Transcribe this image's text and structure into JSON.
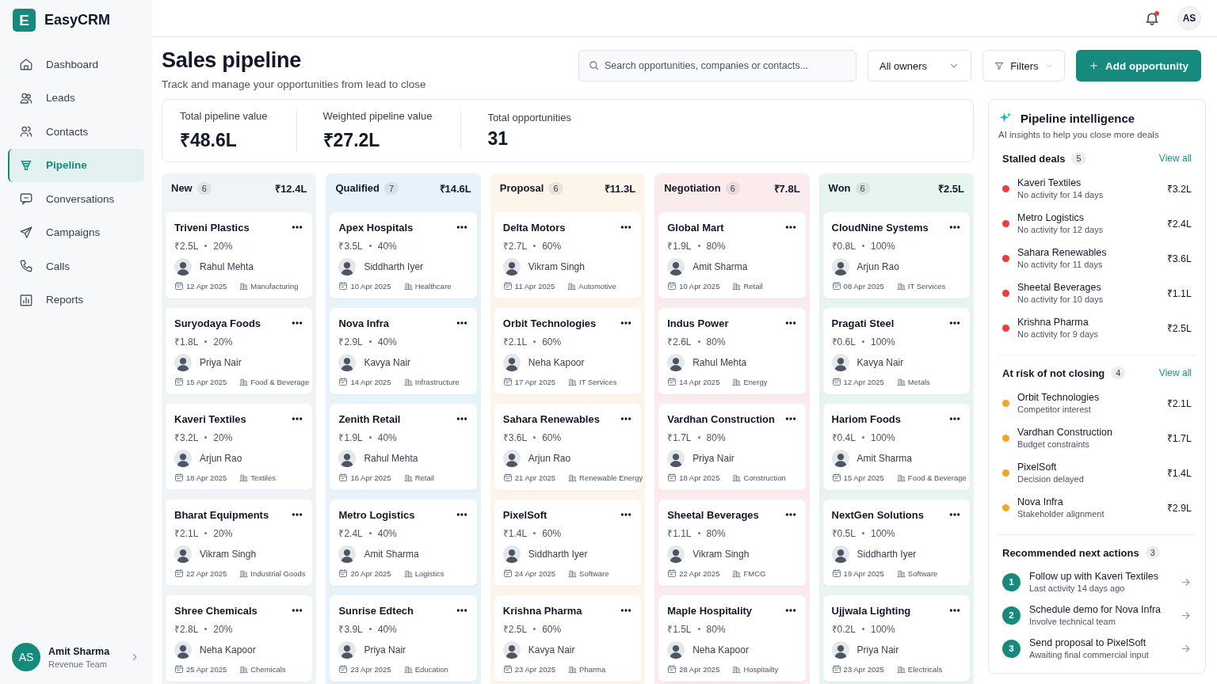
{
  "app": {
    "logo_letter": "E",
    "name": "EasyCRM"
  },
  "sidebar": {
    "items": [
      {
        "label": "Dashboard",
        "selected": false
      },
      {
        "label": "Leads",
        "selected": false
      },
      {
        "label": "Contacts",
        "selected": false
      },
      {
        "label": "Pipeline",
        "selected": true
      },
      {
        "label": "Conversations",
        "selected": false
      },
      {
        "label": "Campaigns",
        "selected": false
      },
      {
        "label": "Calls",
        "selected": false
      },
      {
        "label": "Reports",
        "selected": false
      }
    ]
  },
  "user": {
    "initials": "AS",
    "name": "Amit Sharma",
    "team": "Revenue Team"
  },
  "topbar": {
    "notification_unread": true,
    "avatar_initials": "AS"
  },
  "header": {
    "title": "Sales pipeline",
    "subtitle": "Track and manage your opportunities from lead to close",
    "search": {
      "placeholder": "Search opportunities, companies or contacts..."
    },
    "owner_filter": "All owners",
    "filters_button": "Filters",
    "add_button": "Add opportunity"
  },
  "summary": [
    {
      "label": "Total pipeline value",
      "value": "₹48.6L"
    },
    {
      "label": "Weighted pipeline value",
      "value": "₹27.2L"
    },
    {
      "label": "Total opportunities",
      "value": "31"
    }
  ],
  "columns": [
    {
      "name": "New",
      "count": "6",
      "total": "₹12.4L",
      "color": "#f1f4f7",
      "cards": [
        {
          "company": "Triveni Plastics",
          "value": "₹2.5L",
          "probability": "20%",
          "owner": "Rahul Mehta",
          "date": "12 Apr 2025",
          "industry": "Manufacturing"
        },
        {
          "company": "Suryodaya Foods",
          "value": "₹1.8L",
          "probability": "20%",
          "owner": "Priya Nair",
          "date": "15 Apr 2025",
          "industry": "Food & Beverage"
        },
        {
          "company": "Kaveri Textiles",
          "value": "₹3.2L",
          "probability": "20%",
          "owner": "Arjun Rao",
          "date": "18 Apr 2025",
          "industry": "Textiles"
        },
        {
          "company": "Bharat Equipments",
          "value": "₹2.1L",
          "probability": "20%",
          "owner": "Vikram Singh",
          "date": "22 Apr 2025",
          "industry": "Industrial Goods"
        },
        {
          "company": "Shree Chemicals",
          "value": "₹2.8L",
          "probability": "20%",
          "owner": "Neha Kapoor",
          "date": "25 Apr 2025",
          "industry": "Chemicals"
        }
      ]
    },
    {
      "name": "Qualified",
      "count": "7",
      "total": "₹14.6L",
      "color": "#e7f3fa",
      "cards": [
        {
          "company": "Apex Hospitals",
          "value": "₹3.5L",
          "probability": "40%",
          "owner": "Siddharth Iyer",
          "date": "10 Apr 2025",
          "industry": "Healthcare"
        },
        {
          "company": "Nova Infra",
          "value": "₹2.9L",
          "probability": "40%",
          "owner": "Kavya Nair",
          "date": "14 Apr 2025",
          "industry": "Infrastructure"
        },
        {
          "company": "Zenith Retail",
          "value": "₹1.9L",
          "probability": "40%",
          "owner": "Rahul Mehta",
          "date": "16 Apr 2025",
          "industry": "Retail"
        },
        {
          "company": "Metro Logistics",
          "value": "₹2.4L",
          "probability": "40%",
          "owner": "Amit Sharma",
          "date": "20 Apr 2025",
          "industry": "Logistics"
        },
        {
          "company": "Sunrise Edtech",
          "value": "₹3.9L",
          "probability": "40%",
          "owner": "Priya Nair",
          "date": "23 Apr 2025",
          "industry": "Education"
        }
      ]
    },
    {
      "name": "Proposal",
      "count": "6",
      "total": "₹11.3L",
      "color": "#fdf5ea",
      "cards": [
        {
          "company": "Delta Motors",
          "value": "₹2.7L",
          "probability": "60%",
          "owner": "Vikram Singh",
          "date": "11 Apr 2025",
          "industry": "Automotive"
        },
        {
          "company": "Orbit Technologies",
          "value": "₹2.1L",
          "probability": "60%",
          "owner": "Neha Kapoor",
          "date": "17 Apr 2025",
          "industry": "IT Services"
        },
        {
          "company": "Sahara Renewables",
          "value": "₹3.6L",
          "probability": "60%",
          "owner": "Arjun Rao",
          "date": "21 Apr 2025",
          "industry": "Renewable Energy"
        },
        {
          "company": "PixelSoft",
          "value": "₹1.4L",
          "probability": "60%",
          "owner": "Siddharth Iyer",
          "date": "24 Apr 2025",
          "industry": "Software"
        },
        {
          "company": "Krishna Pharma",
          "value": "₹2.5L",
          "probability": "60%",
          "owner": "Kavya Nair",
          "date": "23 Apr 2025",
          "industry": "Pharma"
        }
      ]
    },
    {
      "name": "Negotiation",
      "count": "6",
      "total": "₹7.8L",
      "color": "#fcebec",
      "cards": [
        {
          "company": "Global Mart",
          "value": "₹1.9L",
          "probability": "80%",
          "owner": "Amit Sharma",
          "date": "10 Apr 2025",
          "industry": "Retail"
        },
        {
          "company": "Indus Power",
          "value": "₹2.6L",
          "probability": "80%",
          "owner": "Rahul Mehta",
          "date": "14 Apr 2025",
          "industry": "Energy"
        },
        {
          "company": "Vardhan Construction",
          "value": "₹1.7L",
          "probability": "80%",
          "owner": "Priya Nair",
          "date": "18 Apr 2025",
          "industry": "Construction"
        },
        {
          "company": "Sheetal Beverages",
          "value": "₹1.1L",
          "probability": "80%",
          "owner": "Vikram Singh",
          "date": "22 Apr 2025",
          "industry": "FMCG"
        },
        {
          "company": "Maple Hospitality",
          "value": "₹1.5L",
          "probability": "80%",
          "owner": "Neha Kapoor",
          "date": "28 Apr 2025",
          "industry": "Hospitailty"
        }
      ]
    },
    {
      "name": "Won",
      "count": "6",
      "total": "₹2.5L",
      "color": "#e6f5ee",
      "cards": [
        {
          "company": "CloudNine Systems",
          "value": "₹0.8L",
          "probability": "100%",
          "owner": "Arjun Rao",
          "date": "08 Apr 2025",
          "industry": "IT Services"
        },
        {
          "company": "Pragati Steel",
          "value": "₹0.6L",
          "probability": "100%",
          "owner": "Kavya Nair",
          "date": "12 Apr 2025",
          "industry": "Metals"
        },
        {
          "company": "Hariom Foods",
          "value": "₹0.4L",
          "probability": "100%",
          "owner": "Amit Sharma",
          "date": "15 Apr 2025",
          "industry": "Food & Beverage"
        },
        {
          "company": "NextGen Solutions",
          "value": "₹0.5L",
          "probability": "100%",
          "owner": "Siddharth Iyer",
          "date": "19 Apr 2025",
          "industry": "Software"
        },
        {
          "company": "Ujjwala Lighting",
          "value": "₹0.2L",
          "probability": "100%",
          "owner": "Priya Nair",
          "date": "23 Apr 2025",
          "industry": "Electricals"
        }
      ]
    }
  ],
  "insights": {
    "title": "Pipeline intelligence",
    "subtitle": "AI insights to help you close more deals",
    "sections": [
      {
        "kind": "deals",
        "title": "Stalled deals",
        "count": "5",
        "link": "View all",
        "items": [
          {
            "name": "Kaveri Textiles",
            "note": "No activity for 14 days",
            "value": "₹3.2L",
            "color": "#ef3b3b"
          },
          {
            "name": "Metro Logistics",
            "note": "No activity for 12 days",
            "value": "₹2.4L",
            "color": "#ef3b3b"
          },
          {
            "name": "Sahara Renewables",
            "note": "No activity for 11 days",
            "value": "₹3.6L",
            "color": "#ef3b3b"
          },
          {
            "name": "Sheetal Beverages",
            "note": "No activity for 10 days",
            "value": "₹1.1L",
            "color": "#ef3b3b"
          },
          {
            "name": "Krishna Pharma",
            "note": "No activity for 9 days",
            "value": "₹2.5L",
            "color": "#ef3b3b"
          }
        ]
      },
      {
        "kind": "deals",
        "title": "At risk of not closing",
        "count": "4",
        "link": "View all",
        "items": [
          {
            "name": "Orbit Technologies",
            "note": "Competitor interest",
            "value": "₹2.1L",
            "color": "#f5a524"
          },
          {
            "name": "Vardhan Construction",
            "note": "Budget constraints",
            "value": "₹1.7L",
            "color": "#f5a524"
          },
          {
            "name": "PixelSoft",
            "note": "Decision delayed",
            "value": "₹1.4L",
            "color": "#f5a524"
          },
          {
            "name": "Nova Infra",
            "note": "Stakeholder alignment",
            "value": "₹2.9L",
            "color": "#f5a524"
          }
        ]
      },
      {
        "kind": "actions",
        "title": "Recommended next actions",
        "count": "3",
        "items": [
          {
            "number": "1",
            "name": "Follow up with Kaveri Textiles",
            "note": "Last activity 14 days ago"
          },
          {
            "number": "2",
            "name": "Schedule demo for Nova Infra",
            "note": "Involve technical team"
          },
          {
            "number": "3",
            "name": "Send proposal to PixelSoft",
            "note": "Awaiting final commercial input"
          }
        ]
      }
    ]
  }
}
